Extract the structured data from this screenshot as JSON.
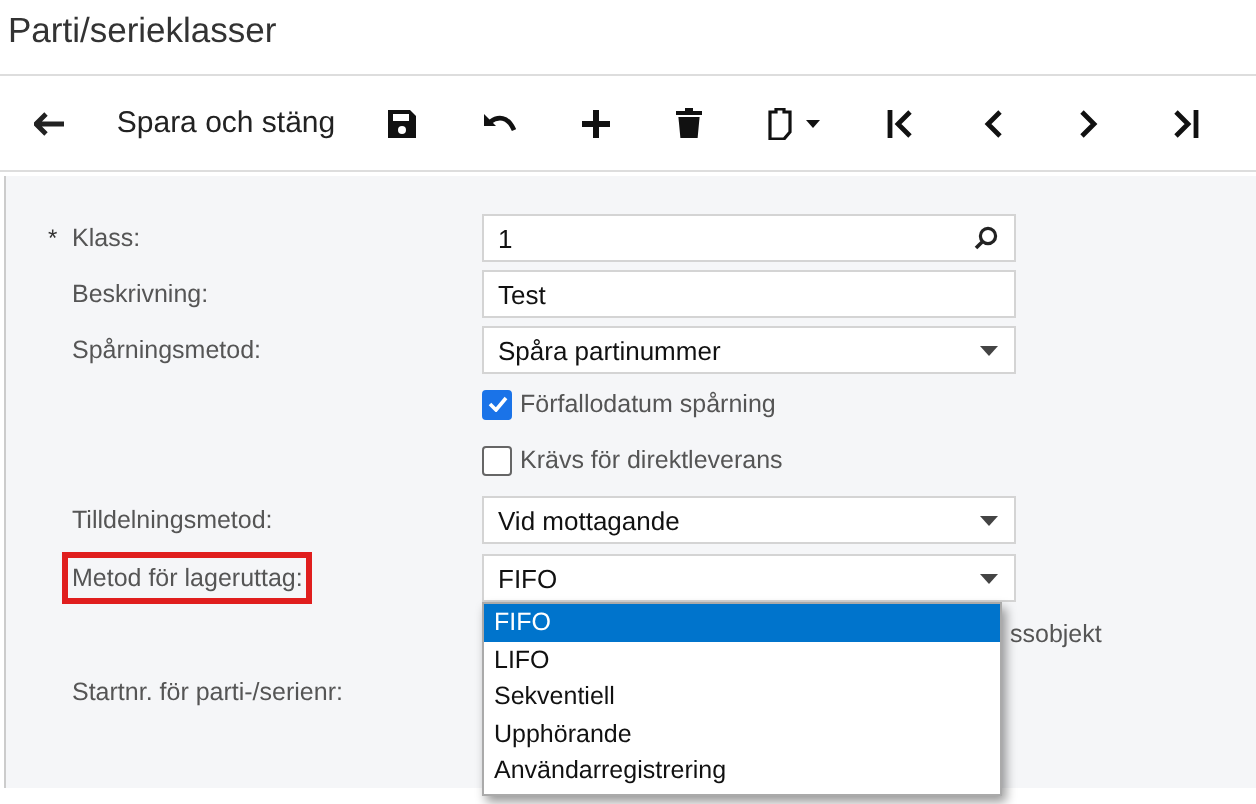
{
  "title": "Parti/serieklasser",
  "toolbar": [
    {
      "kind": "back"
    },
    {
      "kind": "text",
      "label": "Spara och stäng"
    },
    {
      "kind": "save"
    },
    {
      "kind": "undo"
    },
    {
      "kind": "add"
    },
    {
      "kind": "delete"
    },
    {
      "kind": "clipboard"
    },
    {
      "kind": "first"
    },
    {
      "kind": "prev"
    },
    {
      "kind": "next"
    },
    {
      "kind": "last"
    }
  ],
  "fields": [
    {
      "kind": "lookup",
      "label": "Klass:",
      "required_mark": "*",
      "value": "1"
    },
    {
      "kind": "text",
      "label": "Beskrivning:",
      "value": "Test"
    },
    {
      "kind": "select",
      "label": "Spårningsmetod:",
      "value": "Spåra partinummer"
    },
    {
      "kind": "checkbox",
      "label": "Förfallodatum spårning",
      "checked": true
    },
    {
      "kind": "checkbox",
      "label": "Krävs för direktleverans",
      "checked": false
    },
    {
      "kind": "select",
      "label": "Tilldelningsmetod:",
      "value": "Vid mottagande"
    },
    {
      "kind": "select",
      "label": "Metod för lageruttag:",
      "value": "FIFO",
      "highlighted": true,
      "options": [
        {
          "label": "FIFO",
          "selected": true
        },
        {
          "label": "LIFO",
          "selected": false
        },
        {
          "label": "Sekventiell",
          "selected": false
        },
        {
          "label": "Upphörande",
          "selected": false
        },
        {
          "label": "Användarregistrering",
          "selected": false
        }
      ]
    },
    {
      "kind": "covered",
      "label": "ssobjekt"
    },
    {
      "kind": "label-only",
      "label": "Startnr. för parti-/serienr:"
    }
  ]
}
